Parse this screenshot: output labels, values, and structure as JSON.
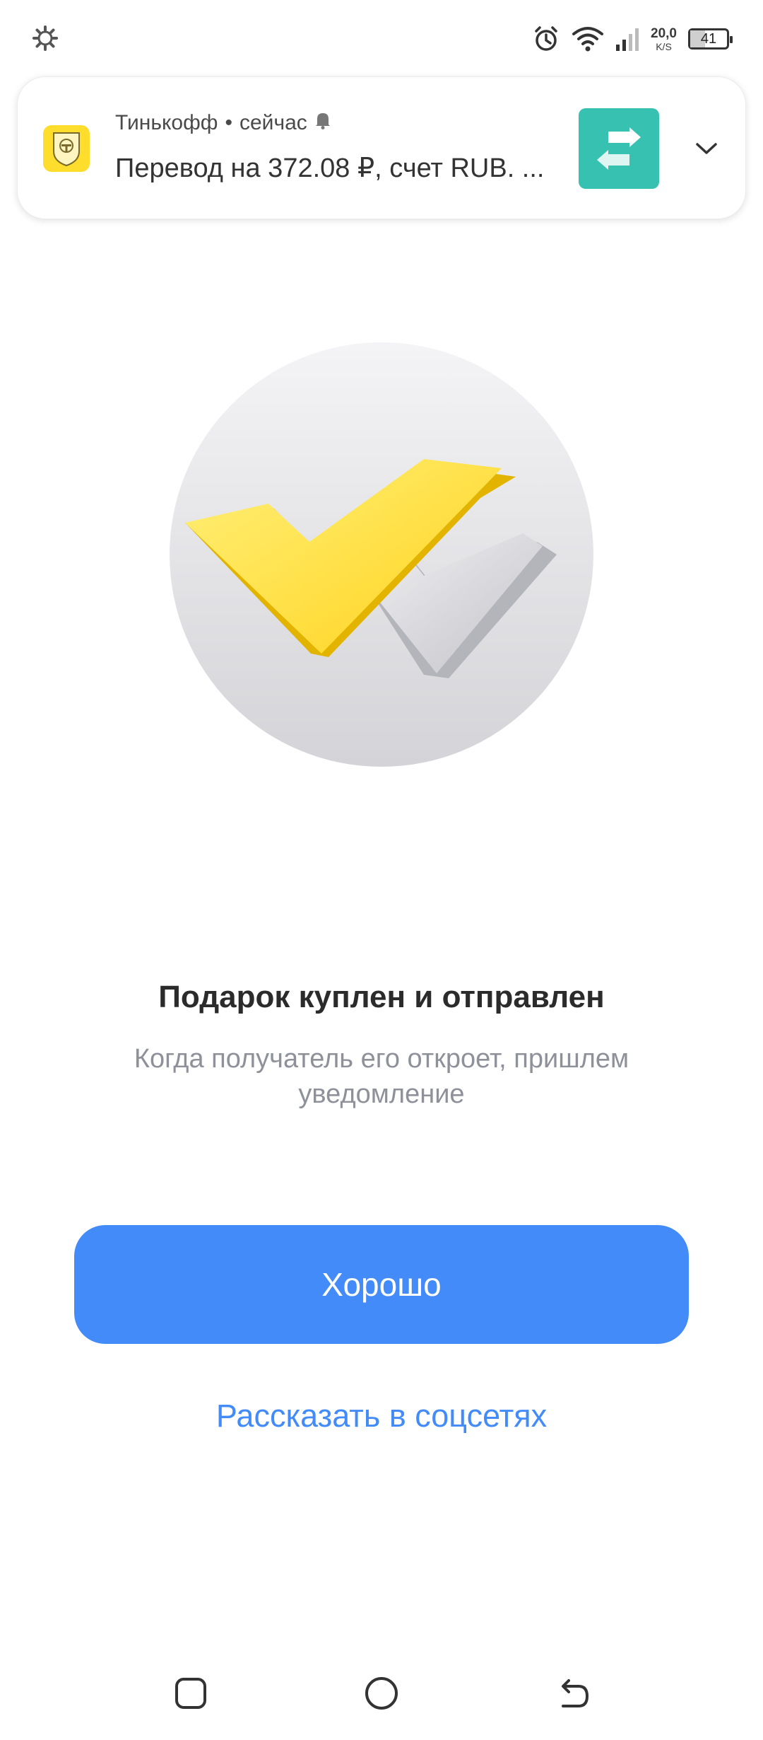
{
  "status_bar": {
    "net_speed_value": "20,0",
    "net_speed_unit": "K/S",
    "battery_level": "41",
    "icons": [
      "settings-gear-icon",
      "alarm-icon",
      "wifi-icon",
      "signal-icon",
      "battery-icon"
    ]
  },
  "notification": {
    "app_name": "Тинькофф",
    "separator": "•",
    "time": "сейчас",
    "body": "Перевод на 372.08 ₽, счет RUB. ...",
    "icon_color": "#ffdd2d",
    "thumbnail_color": "#37c1b0"
  },
  "main": {
    "title": "Подарок куплен и отправлен",
    "subtitle": "Когда получатель его откроет, пришлем уведомление",
    "primary_button_label": "Хорошо",
    "share_link_label": "Рассказать в соцсетях"
  },
  "colors": {
    "accent": "#428bf9",
    "brand_yellow": "#ffdd2d"
  },
  "navbar": {
    "icons": [
      "recents-square-icon",
      "home-circle-icon",
      "back-arrow-icon"
    ]
  }
}
